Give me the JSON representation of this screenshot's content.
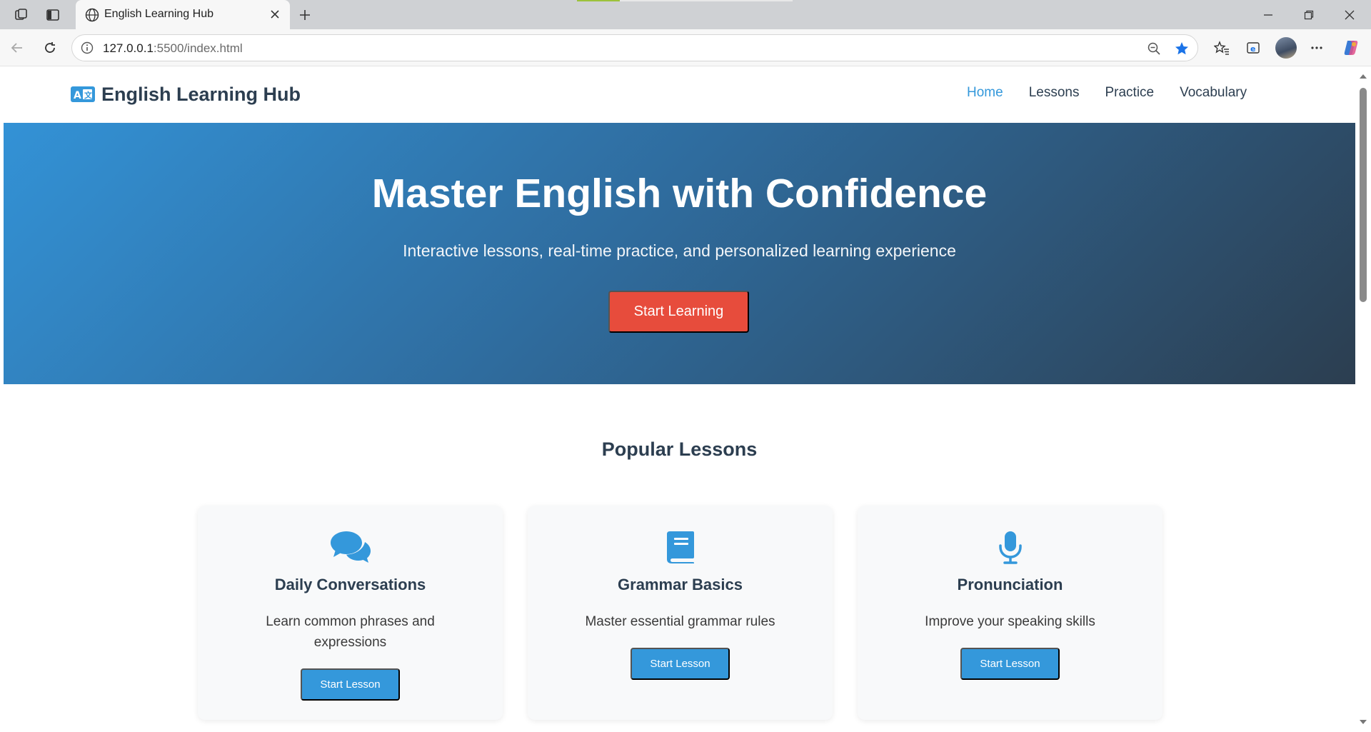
{
  "browser": {
    "tab_title": "English Learning Hub",
    "url_host": "127.0.0.1",
    "url_rest": ":5500/index.html",
    "accent_color": "#1a73e8"
  },
  "site": {
    "logo_text": "English Learning Hub",
    "nav": [
      {
        "label": "Home",
        "active": true
      },
      {
        "label": "Lessons",
        "active": false
      },
      {
        "label": "Practice",
        "active": false
      },
      {
        "label": "Vocabulary",
        "active": false
      }
    ]
  },
  "hero": {
    "title": "Master English with Confidence",
    "subtitle": "Interactive lessons, real-time practice, and personalized learning experience",
    "cta_label": "Start Learning"
  },
  "lessons": {
    "section_title": "Popular Lessons",
    "cards": [
      {
        "icon": "comments-icon",
        "title": "Daily Conversations",
        "description": "Learn common phrases and expressions",
        "button_label": "Start Lesson"
      },
      {
        "icon": "book-icon",
        "title": "Grammar Basics",
        "description": "Master essential grammar rules",
        "button_label": "Start Lesson"
      },
      {
        "icon": "microphone-icon",
        "title": "Pronunciation",
        "description": "Improve your speaking skills",
        "button_label": "Start Lesson"
      }
    ]
  },
  "colors": {
    "primary": "#3498db",
    "dark": "#2c3e50",
    "cta": "#e74c3c"
  }
}
